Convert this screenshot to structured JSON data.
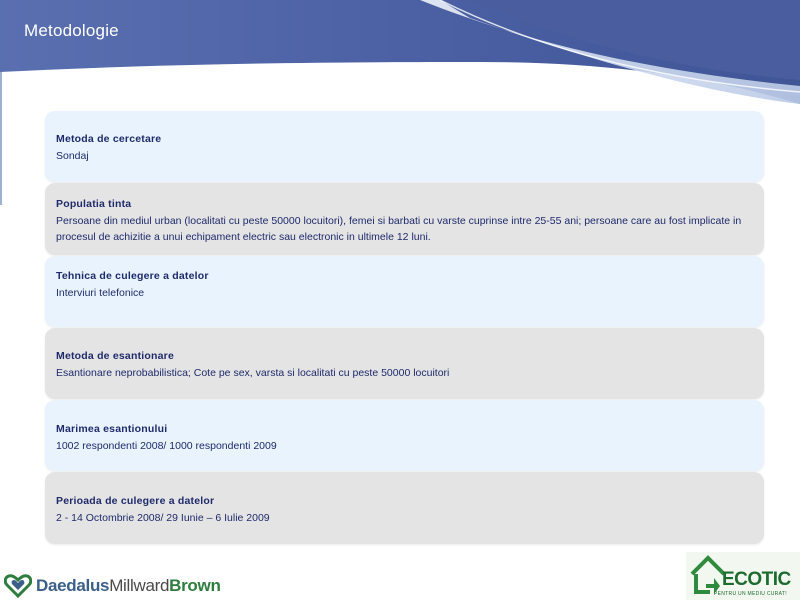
{
  "slide": {
    "title": "Metodologie"
  },
  "rows": [
    {
      "title": "Metoda de cercetare",
      "text": "Sondaj"
    },
    {
      "title": "Populatia tinta",
      "text": "Persoane din mediul urban (localitati cu peste 50000 locuitori), femei si barbati cu varste cuprinse intre 25-55 ani; persoane care au fost implicate in procesul de achizitie a unui echipament electric sau electronic in ultimele 12 luni."
    },
    {
      "title": "Tehnica de culegere a datelor",
      "text": "Interviuri telefonice"
    },
    {
      "title": "Metoda de esantionare",
      "text": "Esantionare neprobabilistica; Cote pe sex, varsta si localitati cu peste 50000 locuitori"
    },
    {
      "title": "Marimea esantionului",
      "text": "1002 respondenti 2008/ 1000 respondenti 2009"
    },
    {
      "title": "Perioada de culegere a datelor",
      "text": "2 - 14 Octombrie 2008/ 29 Iunie – 6 Iulie 2009"
    }
  ],
  "footer": {
    "left_logo": {
      "part1": "Daedalus",
      "part2": "Millward",
      "part3": "Brown"
    },
    "right_logo": {
      "name": "ECOTIC",
      "tagline": "PENTRU UN MEDIU CURAT!"
    }
  },
  "colors": {
    "header_dark": "#3a4f8f",
    "header_light": "#c8d6ee",
    "row_light": "#e8f3fe",
    "row_gray": "#e4e4e4",
    "text": "#1f2a6b"
  }
}
